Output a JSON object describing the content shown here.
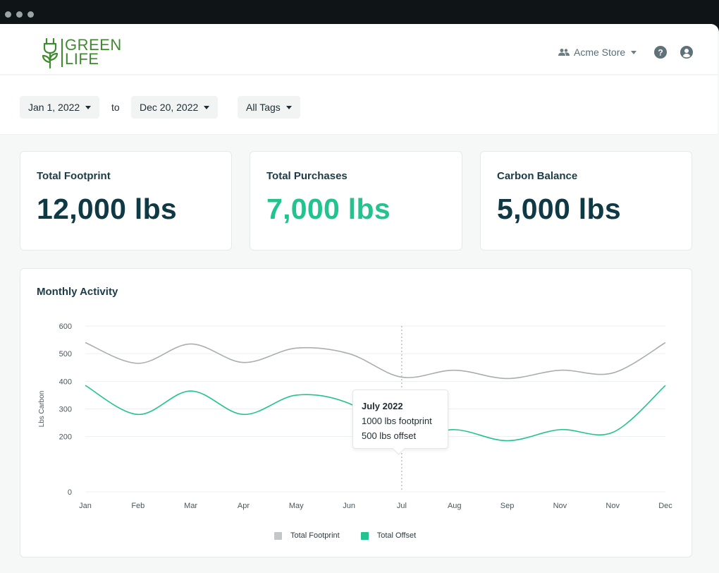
{
  "header": {
    "logo_line1": "GREEN",
    "logo_line2": "LIFE",
    "store_label": "Acme Store",
    "icons": [
      "users-icon",
      "help-icon",
      "user-icon"
    ]
  },
  "filters": {
    "start_date": "Jan 1, 2022",
    "to_label": "to",
    "end_date": "Dec 20, 2022",
    "tags": "All Tags"
  },
  "stats": [
    {
      "label": "Total Footprint",
      "value": "12,000 lbs",
      "color": "#0f3945"
    },
    {
      "label": "Total Purchases",
      "value": "7,000 lbs",
      "color": "#23c38f"
    },
    {
      "label": "Carbon Balance",
      "value": "5,000 lbs",
      "color": "#0f3945"
    }
  ],
  "activity": {
    "title": "Monthly Activity",
    "tooltip": {
      "title": "July 2022",
      "line1": "1000 lbs footprint",
      "line2": "500 lbs offset"
    },
    "legend": [
      "Total Footprint",
      "Total Offset"
    ]
  },
  "colors": {
    "brand_green": "#3f8a2f",
    "offset_green": "#23c38f",
    "footprint_gray": "#a9aeb0",
    "text_dark": "#0f3945"
  },
  "chart_data": {
    "type": "line",
    "title": "Monthly Activity",
    "xlabel": "",
    "ylabel": "Lbs Carbon",
    "categories": [
      "Jan",
      "Feb",
      "Mar",
      "Apr",
      "May",
      "Jun",
      "Jul",
      "Aug",
      "Sep",
      "Nov",
      "Nov",
      "Dec"
    ],
    "y_ticks": [
      0,
      200,
      300,
      400,
      500,
      600
    ],
    "ylim": [
      0,
      600
    ],
    "grid": true,
    "legend_position": "bottom",
    "series": [
      {
        "name": "Total Footprint",
        "color": "#a9aeb0",
        "values": [
          540,
          465,
          535,
          468,
          520,
          500,
          415,
          440,
          410,
          440,
          430,
          540
        ]
      },
      {
        "name": "Total Offset",
        "color": "#23c38f",
        "values": [
          385,
          280,
          365,
          280,
          350,
          320,
          195,
          225,
          185,
          225,
          215,
          385
        ]
      }
    ],
    "highlight": {
      "category_index": 6,
      "series": "Total Offset",
      "value": 175
    }
  }
}
